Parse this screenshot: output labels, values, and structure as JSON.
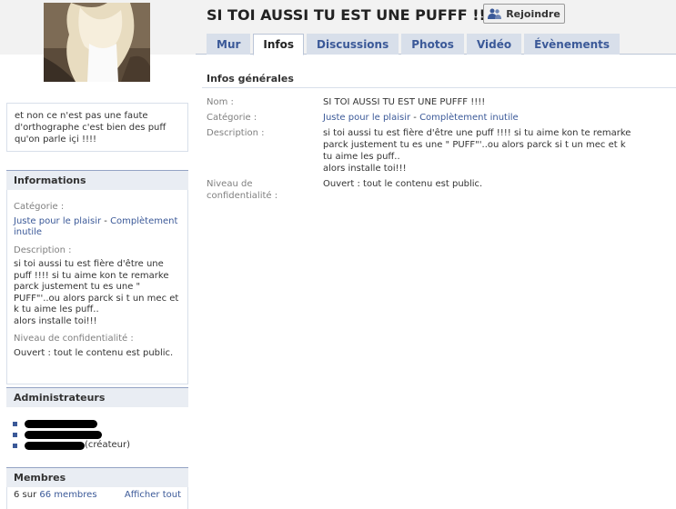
{
  "group": {
    "title": "SI TOI AUSSI TU EST UNE PUFFF !!!!",
    "join_label": "Rejoindre"
  },
  "tabs": [
    {
      "label": "Mur"
    },
    {
      "label": "Infos"
    },
    {
      "label": "Discussions"
    },
    {
      "label": "Photos"
    },
    {
      "label": "Vidéo"
    },
    {
      "label": "Évènements"
    }
  ],
  "sidebar": {
    "description": "et non ce n'est pas une faute d'orthographe c'est bien des puff qu'on parle içi !!!!",
    "informations": {
      "heading": "Informations",
      "category_label": "Catégorie :",
      "category_1": "Juste pour le plaisir",
      "category_sep": " - ",
      "category_2": "Complètement inutile",
      "description_label": "Description :",
      "description_text": "si toi aussi tu est fière d'être une puff !!!! si tu aime kon te remarke parck justement tu es une \" PUFF\"'..ou alors parck si t un mec et k tu aime les puff..",
      "description_text_2": "alors installe toi!!!",
      "privacy_label": "Niveau de confidentialité :",
      "privacy_value": "Ouvert : tout le contenu est public."
    },
    "admins": {
      "heading": "Administrateurs",
      "creator_suffix": "(créateur)"
    },
    "members": {
      "heading": "Membres",
      "count_prefix": "6 sur ",
      "count_link": "66 membres",
      "show_all": "Afficher tout"
    }
  },
  "main": {
    "section_title": "Infos générales",
    "rows": {
      "name_label": "Nom :",
      "name_value": "SI TOI AUSSI TU EST UNE PUFFF !!!!",
      "category_label": "Catégorie :",
      "category_1": "Juste pour le plaisir",
      "category_sep": " - ",
      "category_2": "Complètement inutile",
      "description_label": "Description :",
      "description_text": "si toi aussi tu est fière d'être une puff !!!! si tu aime kon te remarke parck justement tu es une \" PUFF\"'..ou alors parck si t un mec et k tu aime les puff..",
      "description_text_2": "alors installe toi!!!",
      "privacy_label": "Niveau de confidentialité :",
      "privacy_value": "Ouvert : tout le contenu est public."
    }
  },
  "colors": {
    "link": "#3b5998",
    "tab_bg": "#d8dfea",
    "panel_head_bg": "#e9edf3"
  }
}
